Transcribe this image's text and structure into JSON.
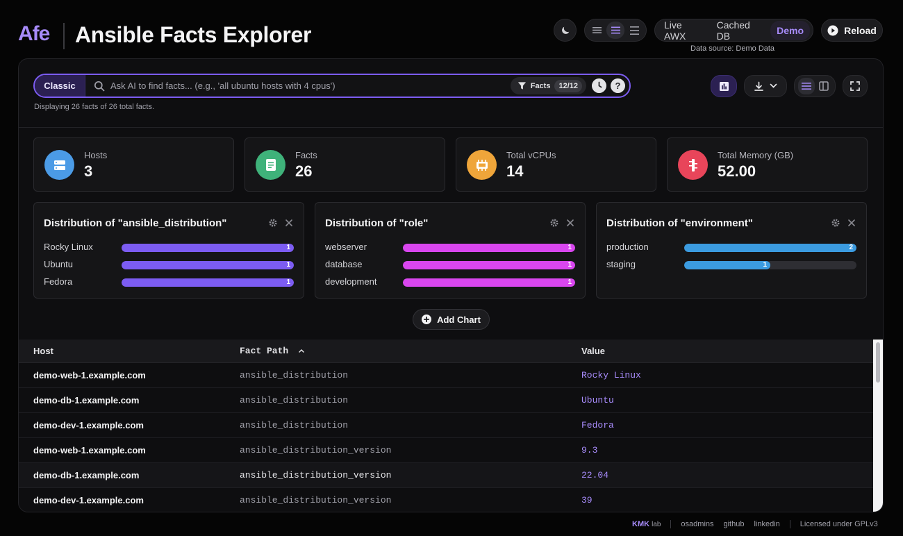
{
  "header": {
    "logo": "Afe",
    "title": "Ansible Facts Explorer",
    "density_options": [
      "compact",
      "comfortable",
      "spacious"
    ],
    "source_options": [
      {
        "label": "Live AWX",
        "active": false
      },
      {
        "label": "Cached DB",
        "active": false
      },
      {
        "label": "Demo",
        "active": true
      }
    ],
    "reload_label": "Reload",
    "data_source": "Data source: Demo Data"
  },
  "search": {
    "mode_label": "Classic",
    "placeholder": "Ask AI to find facts... (e.g., 'all ubuntu hosts with 4 cpus')",
    "facts_label": "Facts",
    "facts_count": "12/12",
    "display_count": "Displaying 26 facts of 26 total facts."
  },
  "stats": [
    {
      "label": "Hosts",
      "value": "3",
      "color": "#4b9be6",
      "icon": "server-icon"
    },
    {
      "label": "Facts",
      "value": "26",
      "color": "#3fb27a",
      "icon": "document-icon"
    },
    {
      "label": "Total vCPUs",
      "value": "14",
      "color": "#efa53a",
      "icon": "cpu-icon"
    },
    {
      "label": "Total Memory (GB)",
      "value": "52.00",
      "color": "#e8455a",
      "icon": "memory-icon"
    }
  ],
  "distributions": [
    {
      "title": "Distribution of \"ansible_distribution\"",
      "color": "#7c5cf2",
      "rows": [
        {
          "label": "Rocky Linux",
          "count": "1",
          "fraction": 1.0
        },
        {
          "label": "Ubuntu",
          "count": "1",
          "fraction": 1.0
        },
        {
          "label": "Fedora",
          "count": "1",
          "fraction": 1.0
        }
      ]
    },
    {
      "title": "Distribution of \"role\"",
      "color": "#d946ef",
      "rows": [
        {
          "label": "webserver",
          "count": "1",
          "fraction": 1.0
        },
        {
          "label": "database",
          "count": "1",
          "fraction": 1.0
        },
        {
          "label": "development",
          "count": "1",
          "fraction": 1.0
        }
      ]
    },
    {
      "title": "Distribution of \"environment\"",
      "color": "#3b9be0",
      "rows": [
        {
          "label": "production",
          "count": "2",
          "fraction": 1.0
        },
        {
          "label": "staging",
          "count": "1",
          "fraction": 0.5
        }
      ]
    }
  ],
  "add_chart_label": "Add Chart",
  "table": {
    "headers": {
      "host": "Host",
      "path": "Fact Path",
      "value": "Value"
    },
    "rows": [
      {
        "host": "demo-web-1.example.com",
        "path": "ansible_distribution",
        "value": "Rocky Linux"
      },
      {
        "host": "demo-db-1.example.com",
        "path": "ansible_distribution",
        "value": "Ubuntu"
      },
      {
        "host": "demo-dev-1.example.com",
        "path": "ansible_distribution",
        "value": "Fedora"
      },
      {
        "host": "demo-web-1.example.com",
        "path": "ansible_distribution_version",
        "value": "9.3"
      },
      {
        "host": "demo-db-1.example.com",
        "path": "ansible_distribution_version",
        "value": "22.04"
      },
      {
        "host": "demo-dev-1.example.com",
        "path": "ansible_distribution_version",
        "value": "39"
      }
    ]
  },
  "footer": {
    "brand": "KMK",
    "brand_suffix": "lab",
    "links": [
      "osadmins",
      "github",
      "linkedin"
    ],
    "license": "Licensed under GPLv3"
  }
}
